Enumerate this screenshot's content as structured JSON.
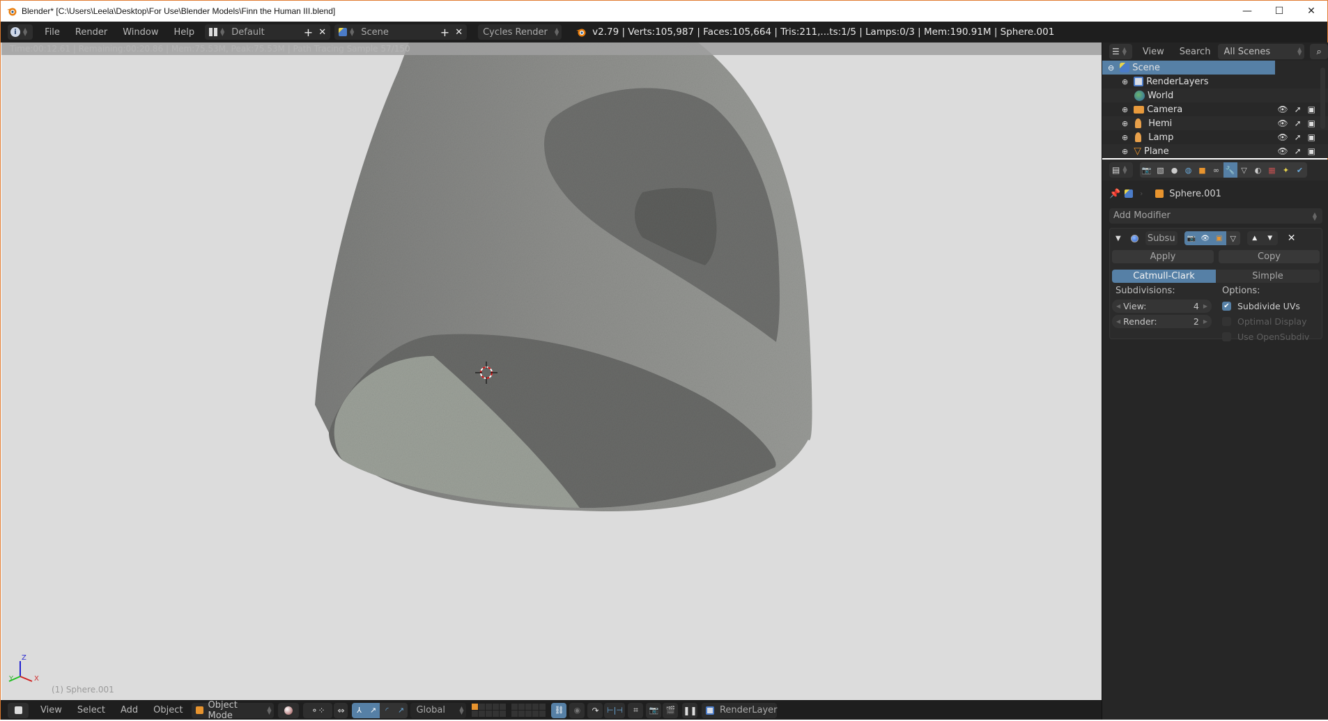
{
  "window": {
    "title": "Blender* [C:\\Users\\Leela\\Desktop\\For Use\\Blender Models\\Finn the Human III.blend]",
    "controls": {
      "minimize": "—",
      "maximize": "☐",
      "close": "✕"
    },
    "accent_color": "#e07a2e"
  },
  "topbar": {
    "menus": [
      "File",
      "Render",
      "Window",
      "Help"
    ],
    "layout": "Default",
    "scene": "Scene",
    "engine": "Cycles Render",
    "info": "v2.79 | Verts:105,987 | Faces:105,664 | Tris:211,...ts:1/5 | Lamps:0/3 | Mem:190.91M | Sphere.001",
    "add_glyph": "+",
    "close_glyph": "✕"
  },
  "viewport": {
    "render_status": "Time:00:12.61 | Remaining:00:20.86 | Mem:75.53M, Peak:75.53M | Path Tracing Sample 57/150",
    "render_samples_done": 57,
    "render_samples_total": 150,
    "object_label": "(1) Sphere.001",
    "axes": {
      "x": "X",
      "y": "Y",
      "z": "Z"
    }
  },
  "outliner": {
    "header": {
      "view": "View",
      "search": "Search",
      "filter": "All Scenes"
    },
    "rows": [
      {
        "name": "Scene",
        "icon": "scene-icon",
        "selected": true
      },
      {
        "name": "RenderLayers",
        "icon": "render-layers-icon"
      },
      {
        "name": "World",
        "icon": "world-icon"
      },
      {
        "name": "Camera",
        "icon": "camera-icon"
      },
      {
        "name": "Hemi",
        "icon": "lamp-icon"
      },
      {
        "name": "Lamp",
        "icon": "lamp-icon"
      },
      {
        "name": "Plane",
        "icon": "mesh-icon"
      }
    ]
  },
  "properties": {
    "context_object": "Sphere.001",
    "add_modifier": "Add Modifier",
    "modifier": {
      "name": "Subsu",
      "apply": "Apply",
      "copy": "Copy",
      "type_options": [
        "Catmull-Clark",
        "Simple"
      ],
      "active_type": "Catmull-Clark",
      "subdivisions_label": "Subdivisions:",
      "view_label": "View:",
      "view_value": "4",
      "render_label": "Render:",
      "render_value": "2",
      "options_label": "Options:",
      "options": [
        {
          "label": "Subdivide UVs",
          "checked": true,
          "enabled": true
        },
        {
          "label": "Optimal Display",
          "checked": false,
          "enabled": false
        },
        {
          "label": "Use OpenSubdiv",
          "checked": false,
          "enabled": false
        }
      ]
    },
    "active_tab_color": "#5680a6"
  },
  "bottombar": {
    "menus": [
      "View",
      "Select",
      "Add",
      "Object"
    ],
    "mode": "Object Mode",
    "orientation": "Global",
    "render_layer": "RenderLayer"
  }
}
